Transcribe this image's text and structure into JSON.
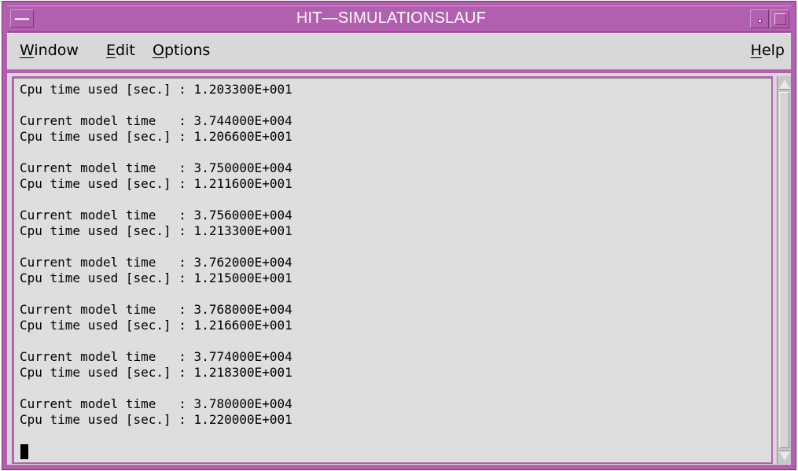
{
  "window": {
    "title": "HIT—SIMULATIONSLAUF"
  },
  "menubar": {
    "items": [
      {
        "label": "Window",
        "mnemonic": "W",
        "rest": "indow"
      },
      {
        "label": "Edit",
        "mnemonic": "E",
        "rest": "dit"
      },
      {
        "label": "Options",
        "mnemonic": "O",
        "rest": "ptions"
      }
    ],
    "help": {
      "label": "Help",
      "mnemonic": "H",
      "rest": "elp"
    }
  },
  "output": {
    "lines": [
      "Cpu time used [sec.] : 1.203300E+001",
      "",
      "Current model time   : 3.744000E+004",
      "Cpu time used [sec.] : 1.206600E+001",
      "",
      "Current model time   : 3.750000E+004",
      "Cpu time used [sec.] : 1.211600E+001",
      "",
      "Current model time   : 3.756000E+004",
      "Cpu time used [sec.] : 1.213300E+001",
      "",
      "Current model time   : 3.762000E+004",
      "Cpu time used [sec.] : 1.215000E+001",
      "",
      "Current model time   : 3.768000E+004",
      "Cpu time used [sec.] : 1.216600E+001",
      "",
      "Current model time   : 3.774000E+004",
      "Cpu time used [sec.] : 1.218300E+001",
      "",
      "Current model time   : 3.780000E+004",
      "Cpu time used [sec.] : 1.220000E+001"
    ]
  },
  "colors": {
    "frame": "#b35fb0",
    "background": "#d8d8d8",
    "text_area": "#dedede"
  }
}
